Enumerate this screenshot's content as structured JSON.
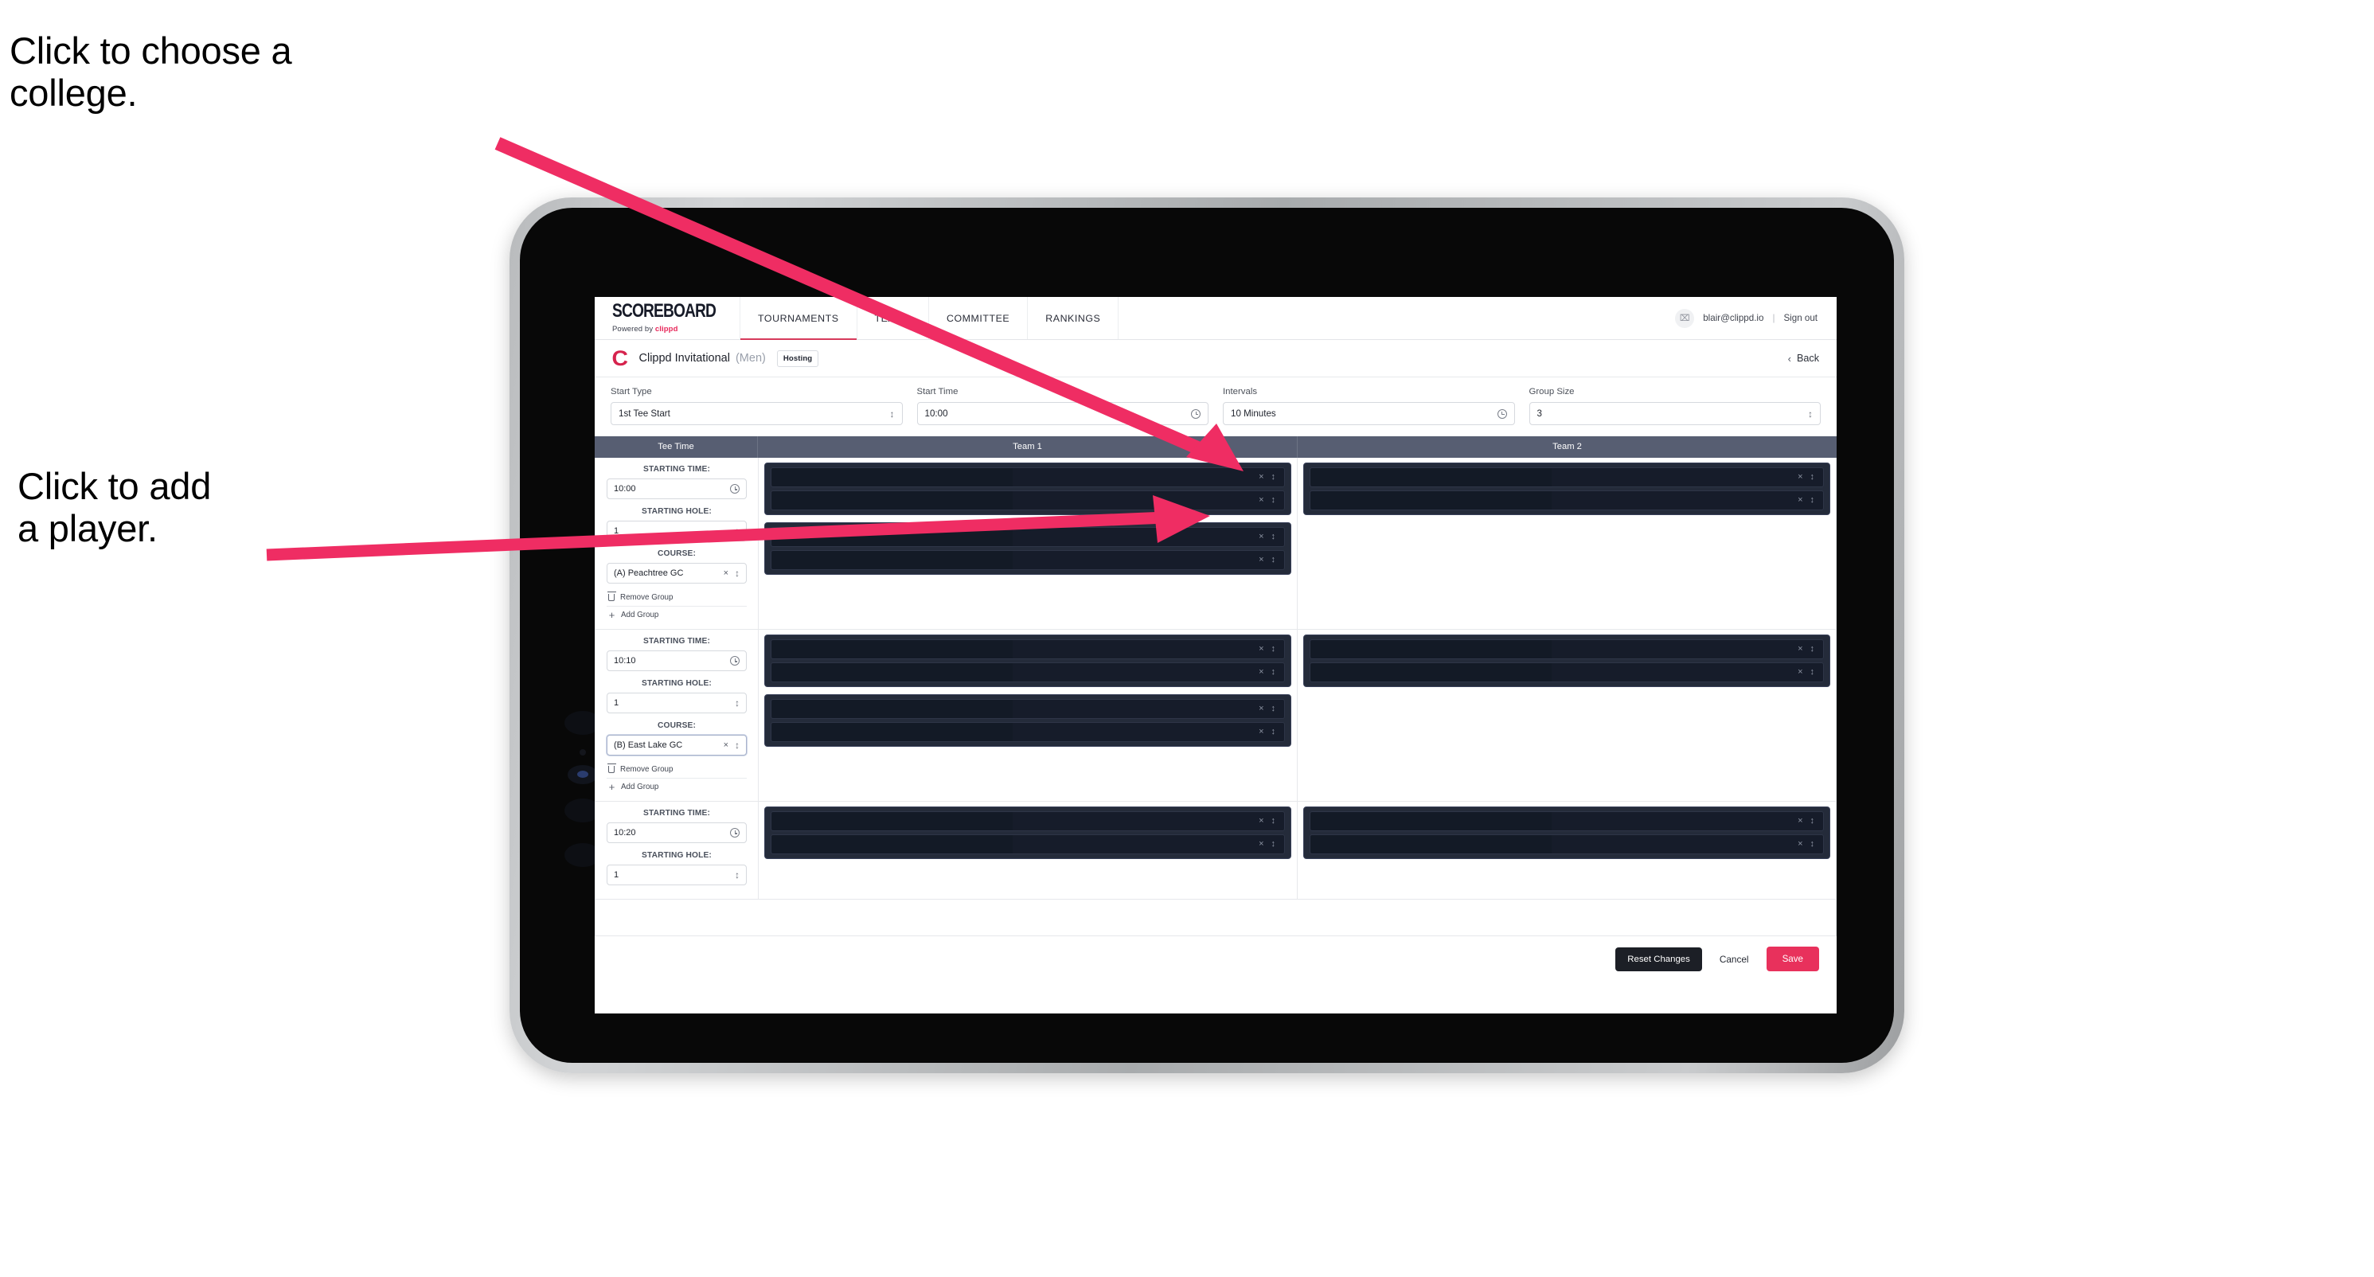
{
  "annotations": {
    "college": "Click to choose a\ncollege.",
    "player": "Click to add\na player.",
    "arrow_color": "#EF2D63"
  },
  "nav": {
    "brand_word": "SCOREBOARD",
    "brand_sub_prefix": "Powered by ",
    "brand_sub_name": "clippd",
    "items": [
      {
        "label": "TOURNAMENTS",
        "active": true
      },
      {
        "label": "TEAMS",
        "active": false
      },
      {
        "label": "COMMITTEE",
        "active": false
      },
      {
        "label": "RANKINGS",
        "active": false
      }
    ],
    "account_email": "blair@clippd.io",
    "separator": "|",
    "sign_out": "Sign out",
    "avatar_glyph": "⌧"
  },
  "tournament": {
    "logo_letter": "C",
    "name": "Clippd Invitational",
    "gender": "(Men)",
    "badge": "Hosting",
    "back_label": "Back",
    "back_chevron": "‹"
  },
  "settings": {
    "fields": [
      {
        "label": "Start Type",
        "value": "1st Tee Start",
        "control": "select"
      },
      {
        "label": "Start Time",
        "value": "10:00",
        "control": "time"
      },
      {
        "label": "Intervals",
        "value": "10 Minutes",
        "control": "time"
      },
      {
        "label": "Group Size",
        "value": "3",
        "control": "select"
      }
    ]
  },
  "table": {
    "headers": [
      "Tee Time",
      "Team 1",
      "Team 2"
    ],
    "labels": {
      "starting_time": "STARTING TIME:",
      "starting_hole": "STARTING HOLE:",
      "course": "COURSE:",
      "remove_group": "Remove Group",
      "add_group": "Add Group"
    },
    "rows": [
      {
        "starting_time": "10:00",
        "starting_hole": "1",
        "course": "(A) Peachtree GC",
        "course_focused": false,
        "team1_groups": [
          {
            "slots": [
              "",
              ""
            ]
          },
          {
            "slots": [
              "",
              ""
            ]
          }
        ],
        "team2_groups": [
          {
            "slots": [
              "",
              ""
            ]
          }
        ]
      },
      {
        "starting_time": "10:10",
        "starting_hole": "1",
        "course": "(B) East Lake GC",
        "course_focused": true,
        "team1_groups": [
          {
            "slots": [
              "",
              ""
            ]
          },
          {
            "slots": [
              "",
              ""
            ]
          }
        ],
        "team2_groups": [
          {
            "slots": [
              "",
              ""
            ]
          }
        ]
      },
      {
        "starting_time": "10:20",
        "starting_hole": "1",
        "course": "",
        "course_focused": false,
        "team1_groups": [
          {
            "slots": [
              "",
              ""
            ]
          }
        ],
        "team2_groups": [
          {
            "slots": [
              "",
              ""
            ]
          }
        ]
      }
    ],
    "clear_glyph": "×",
    "spinner_glyph": "⌃⌄"
  },
  "footer": {
    "reset_label": "Reset Changes",
    "cancel_label": "Cancel",
    "save_label": "Save"
  },
  "colors": {
    "accent_pink": "#E8315C",
    "nav_underline": "#D63A5B",
    "table_header_bg": "#575E72",
    "slot_bg": "#161C2A",
    "group_bg": "#242B3A"
  }
}
